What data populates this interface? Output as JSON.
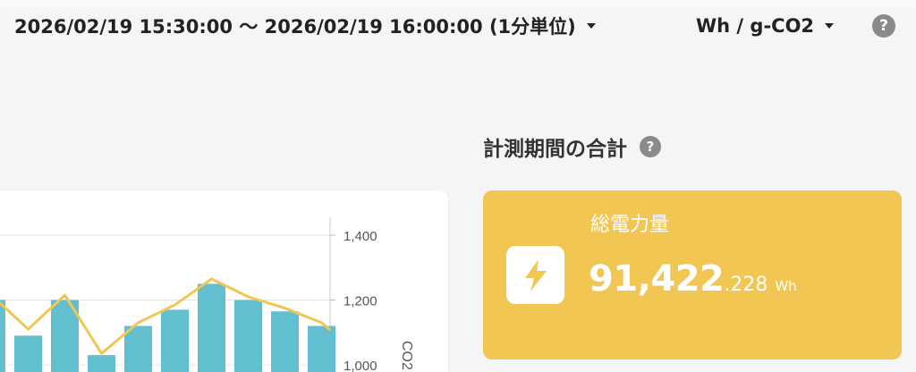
{
  "header": {
    "period_label": "2026/02/19 15:30:00 〜 2026/02/19 16:00:00 (1分単位)",
    "unit_label": "Wh / g-CO2",
    "help_icon": "?"
  },
  "summary": {
    "title": "計測期間の合計",
    "help_icon": "?",
    "card": {
      "label": "総電力量",
      "value_int": "91,422",
      "value_dec": ".228",
      "unit": "Wh",
      "icon": "bolt-icon",
      "accent": "#f1c652"
    }
  },
  "chart_data": {
    "type": "bar",
    "y2_ticks": [
      "1,400",
      "1,200",
      "1,000"
    ],
    "y2_label": "CO2",
    "y2_range": [
      1000,
      1400
    ],
    "bars": {
      "color": "#62bfcf",
      "values": [
        1200,
        1090,
        1200,
        1030,
        1120,
        1170,
        1250,
        1200,
        1165,
        1120
      ]
    },
    "line": {
      "color": "#f1c652",
      "values": [
        1215,
        1110,
        1215,
        1035,
        1130,
        1185,
        1265,
        1210,
        1175,
        1130
      ]
    }
  }
}
